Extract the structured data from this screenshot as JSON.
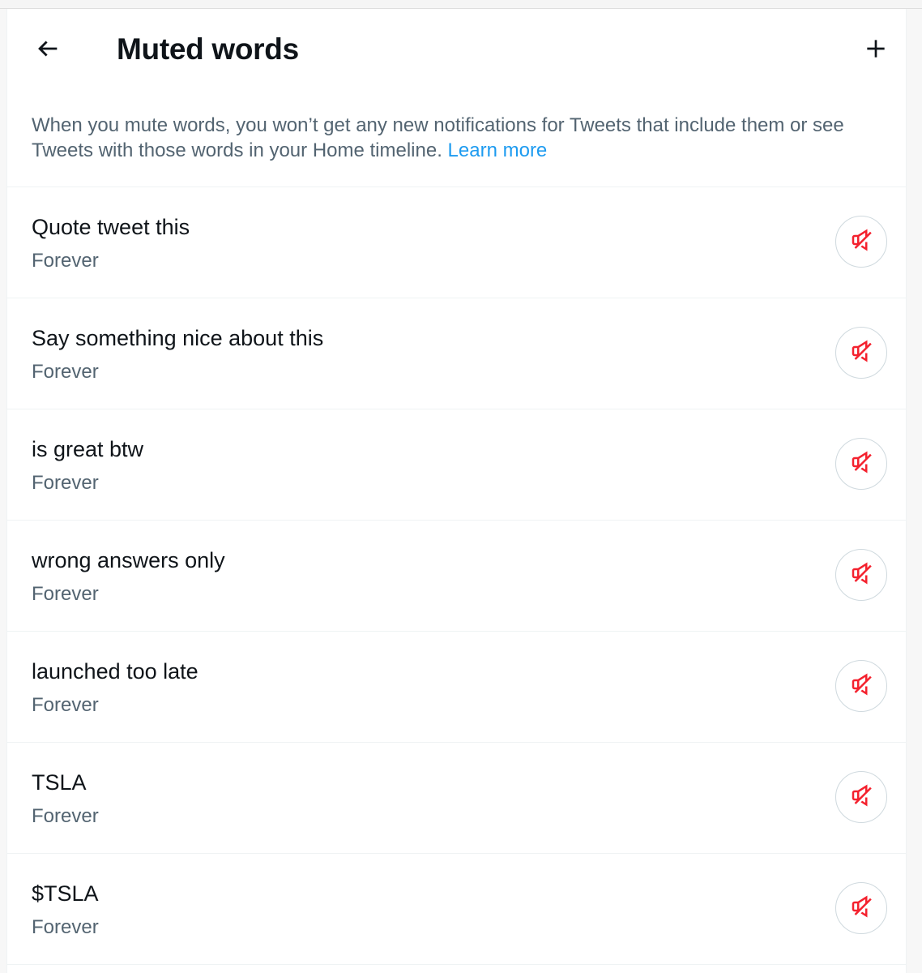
{
  "header": {
    "title": "Muted words",
    "back_icon": "arrow-left-icon",
    "add_icon": "plus-icon"
  },
  "description": {
    "text": "When you mute words, you won’t get any new notifications for Tweets that include them or see Tweets with those words in your Home timeline.",
    "link_label": "Learn more"
  },
  "colors": {
    "text_primary": "#0f1419",
    "text_secondary": "#536471",
    "link": "#1d9bf0",
    "unmute_icon": "#f4212e"
  },
  "muted_words": [
    {
      "word": "Quote tweet this",
      "duration": "Forever"
    },
    {
      "word": "Say something nice about this",
      "duration": "Forever"
    },
    {
      "word": "is great btw",
      "duration": "Forever"
    },
    {
      "word": "wrong answers only",
      "duration": "Forever"
    },
    {
      "word": "launched too late",
      "duration": "Forever"
    },
    {
      "word": "TSLA",
      "duration": "Forever"
    },
    {
      "word": "$TSLA",
      "duration": "Forever"
    }
  ]
}
